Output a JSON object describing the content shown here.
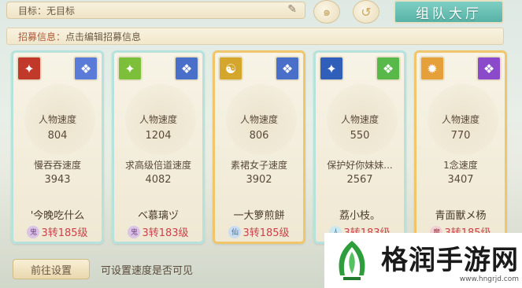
{
  "target": {
    "label": "目标：无目标"
  },
  "team_hall": {
    "label": "组队大厅"
  },
  "recruit": {
    "label": "招募信息：",
    "text": "点击编辑招募信息"
  },
  "cards": [
    {
      "speed_label": "人物速度",
      "speed": "804",
      "other_label": "慢吞吞速度",
      "other_speed": "3943",
      "name": "'今晚吃什么",
      "school": "鬼",
      "level": "3转185级",
      "icon_left_color": "#c0392b",
      "icon_right_color": "#5b7bd8",
      "highlight": false
    },
    {
      "speed_label": "人物速度",
      "speed": "1204",
      "other_label": "求高级倍道速度",
      "other_speed": "4082",
      "name": "ベ慕璃ヅ",
      "school": "鬼",
      "level": "3转183级",
      "icon_left_color": "#7bbf3a",
      "icon_right_color": "#4a6fc9",
      "highlight": false
    },
    {
      "speed_label": "人物速度",
      "speed": "806",
      "other_label": "素裙女子速度",
      "other_speed": "3902",
      "name": "一大箩煎餅",
      "school": "仙",
      "level": "3转185级",
      "icon_left_color": "#d4a72c",
      "icon_right_color": "#4a6fc9",
      "highlight": true
    },
    {
      "speed_label": "人物速度",
      "speed": "550",
      "other_label": "保护好你妹妹...",
      "other_speed": "2567",
      "name": "荔小枝。",
      "school": "人",
      "level": "3转183级",
      "icon_left_color": "#2f5fb8",
      "icon_right_color": "#59b84a",
      "highlight": false
    },
    {
      "speed_label": "人物速度",
      "speed": "770",
      "other_label": "1念速度",
      "other_speed": "3407",
      "name": "青面獸メ杨",
      "school": "魔",
      "level": "3转185级",
      "icon_left_color": "#e6a03a",
      "icon_right_color": "#8a4ac9",
      "highlight": true
    }
  ],
  "bottom": {
    "button_label": "前往设置",
    "hint": "可设置速度是否可见"
  },
  "watermark": {
    "title": "格润手游网",
    "url": "www.hngrjd.com"
  }
}
